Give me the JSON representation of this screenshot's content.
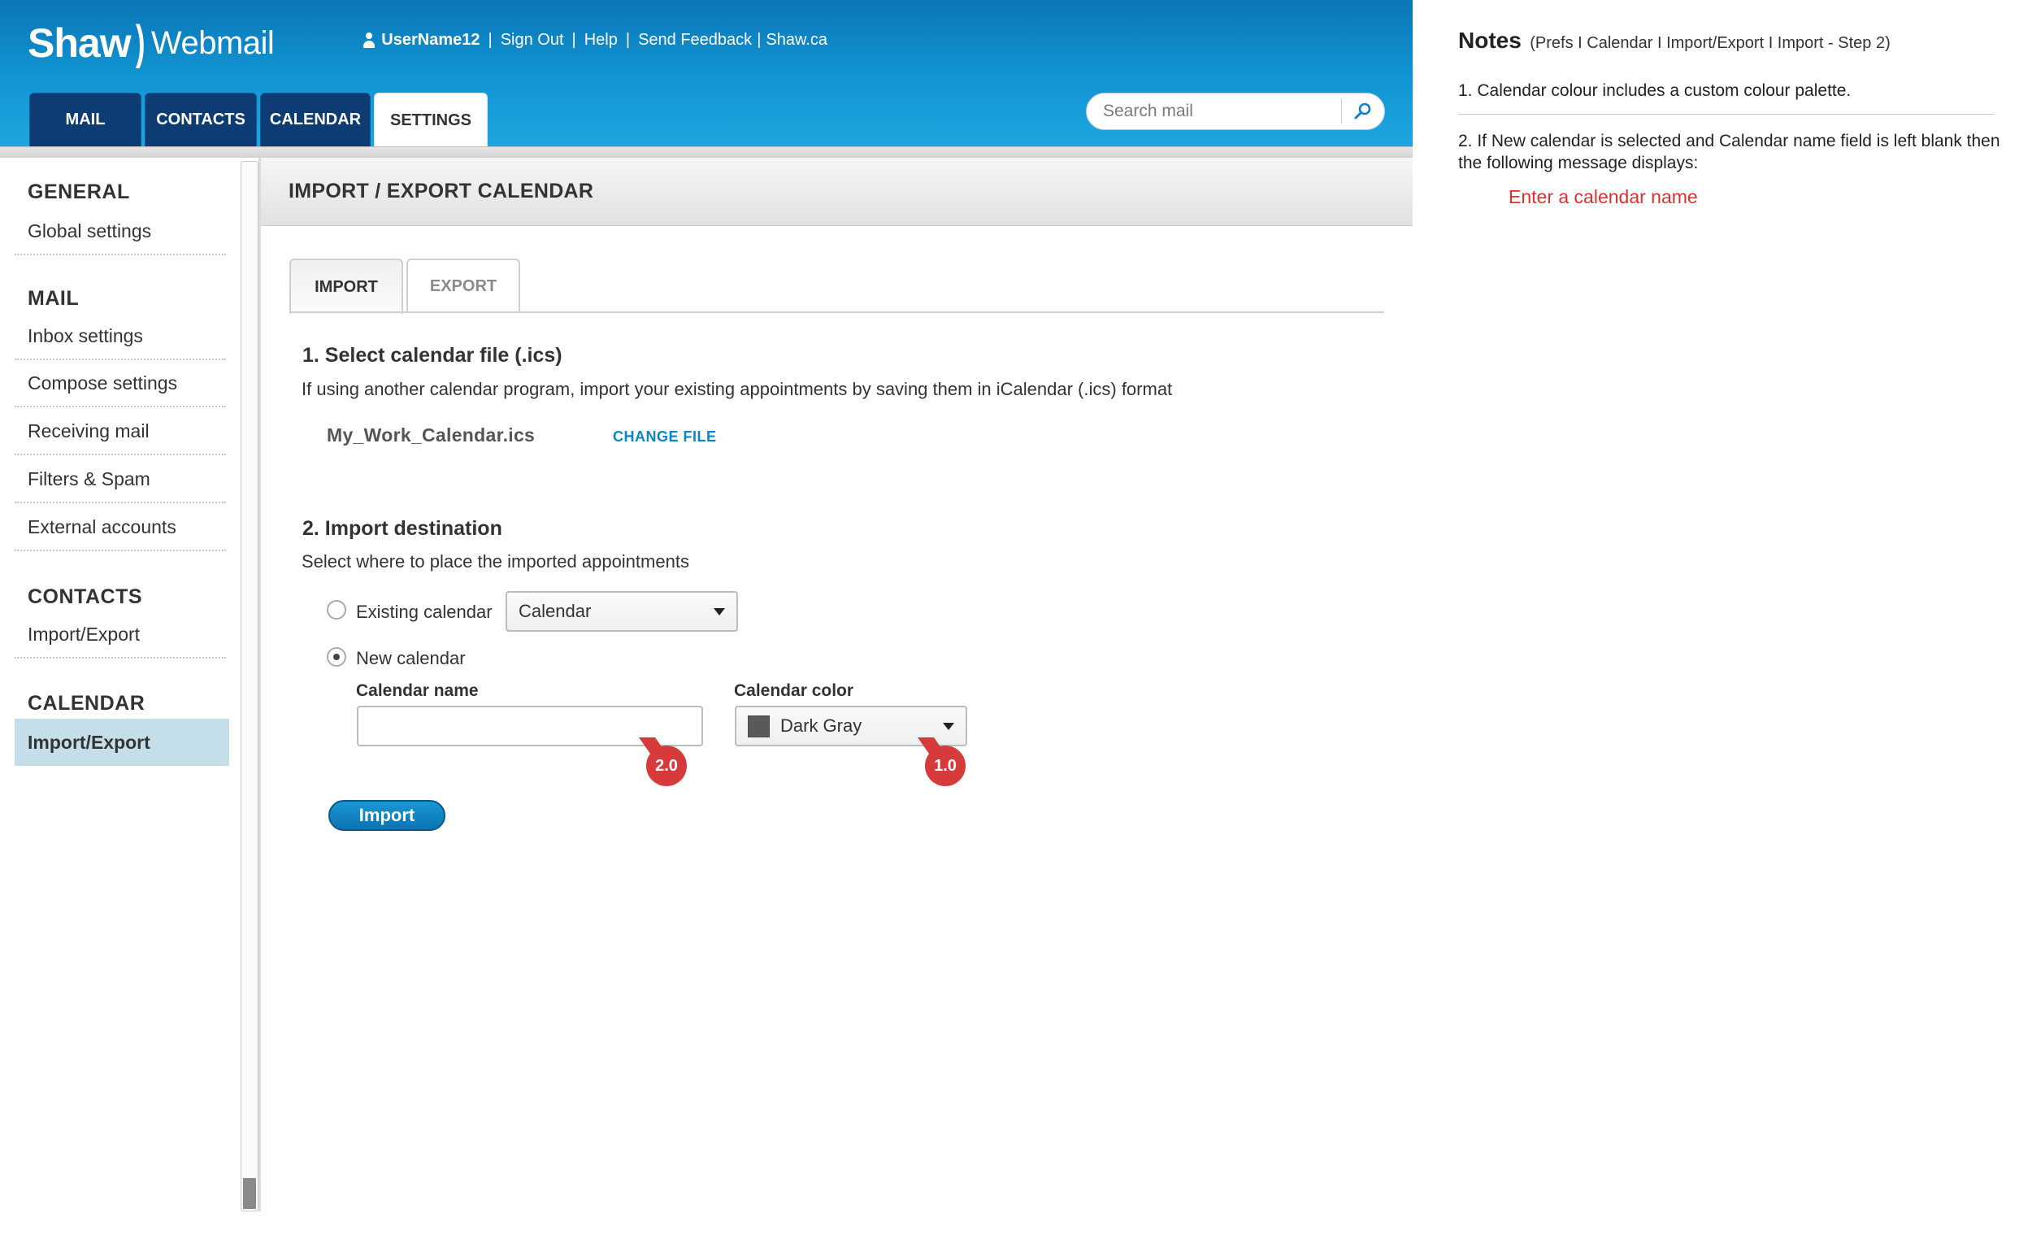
{
  "brand": {
    "name": "Shaw",
    "arc": ")",
    "product": "Webmail"
  },
  "toplinks": {
    "username": "UserName12",
    "sign_out": "Sign Out",
    "help": "Help",
    "send_feedback": "Send Feedback",
    "site": "Shaw.ca",
    "sep": "|"
  },
  "nav_tabs": [
    "MAIL",
    "CONTACTS",
    "CALENDAR",
    "SETTINGS"
  ],
  "active_tab": "SETTINGS",
  "search": {
    "placeholder": "Search mail",
    "icon": "search-icon"
  },
  "sidebar": {
    "general": {
      "heading": "GENERAL",
      "items": [
        "Global settings"
      ]
    },
    "mail": {
      "heading": "MAIL",
      "items": [
        "Inbox settings",
        "Compose settings",
        "Receiving mail",
        "Filters & Spam",
        "External accounts"
      ]
    },
    "contacts": {
      "heading": "CONTACTS",
      "items": [
        "Import/Export"
      ]
    },
    "calendar": {
      "heading": "CALENDAR",
      "items": [
        "Import/Export"
      ]
    }
  },
  "main": {
    "title": "IMPORT / EXPORT CALENDAR",
    "subtabs": [
      "IMPORT",
      "EXPORT"
    ],
    "active_subtab": "IMPORT",
    "section1": {
      "title": "1. Select calendar file (.ics)",
      "desc": "If using another calendar program, import your existing appointments by saving them in iCalendar (.ics) format",
      "filename": "My_Work_Calendar.ics",
      "change_file": "CHANGE FILE"
    },
    "section2": {
      "title": "2. Import destination",
      "desc": "Select where to place the imported appointments",
      "existing_label": "Existing calendar",
      "existing_value": "Calendar",
      "new_label": "New calendar",
      "selected_option": "New calendar",
      "name_label": "Calendar name",
      "name_value": "",
      "color_label": "Calendar color",
      "color_value": "Dark Gray",
      "color_swatch": "#595959"
    },
    "markers": [
      "2.0",
      "1.0"
    ],
    "import_button": "Import"
  },
  "notes": {
    "title": "Notes",
    "crumb": "(Prefs I Calendar I Import/Export I Import - Step 2)",
    "note1": "1. Calendar colour includes a custom colour palette.",
    "note2": "2. If New calendar is selected and Calendar name field is left blank then the following message displays:",
    "message": "Enter a calendar name"
  },
  "colors": {
    "header_blue": "#1296d3",
    "nav_tab_navy": "#0d3b73",
    "sidebar_active": "#c4dfea",
    "link_blue": "#0a86c8",
    "marker_red": "#d63a3a",
    "error_red": "#e12e2e"
  }
}
